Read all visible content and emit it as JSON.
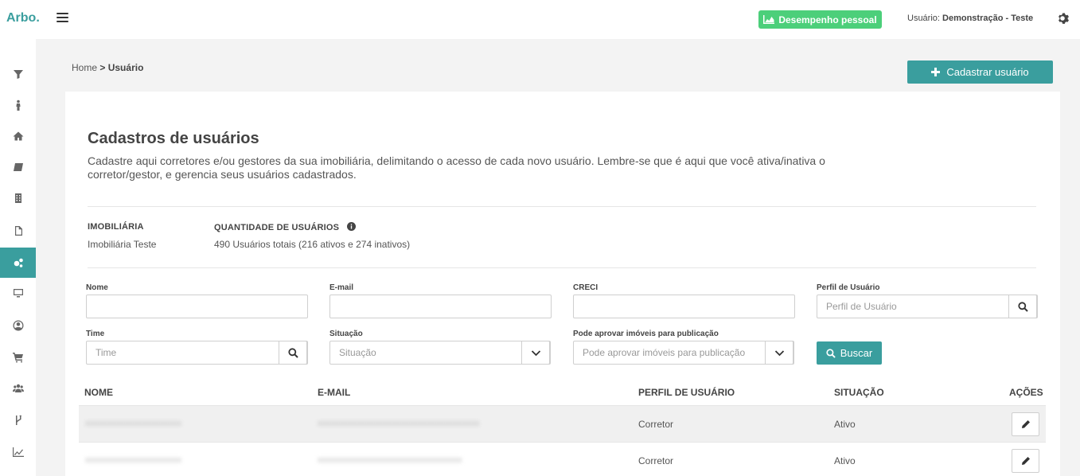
{
  "header": {
    "brand": "Arbo.",
    "performance_button": "Desempenho pessoal",
    "user_prefix": "Usuário:",
    "user_name": "Demonstração - Teste"
  },
  "sidebar": {
    "items": [
      {
        "icon": "filter-icon"
      },
      {
        "icon": "person-icon"
      },
      {
        "icon": "home-icon"
      },
      {
        "icon": "book-icon"
      },
      {
        "icon": "building-icon"
      },
      {
        "icon": "document-icon"
      },
      {
        "icon": "gears-icon",
        "active": true
      },
      {
        "icon": "monitor-icon"
      },
      {
        "icon": "user-circle-icon"
      },
      {
        "icon": "cart-icon"
      },
      {
        "icon": "users-icon"
      },
      {
        "icon": "fork-icon"
      },
      {
        "icon": "chart-icon"
      }
    ]
  },
  "breadcrumb": {
    "home": "Home",
    "separator": ">",
    "current": "Usuário"
  },
  "add_user_button": "Cadastrar usuário",
  "page": {
    "title": "Cadastros de usuários",
    "description": "Cadastre aqui corretores e/ou gestores da sua imobiliária, delimitando o acesso de cada novo usuário. Lembre-se que é aqui que você ativa/inativa o corretor/gestor, e gerencia seus usuários cadastrados."
  },
  "info": {
    "agency_label": "IMOBILIÁRIA",
    "agency_value": "Imobiliária Teste",
    "count_label": "QUANTIDADE DE USUÁRIOS",
    "count_value": "490 Usuários totais (216 ativos e 274 inativos)"
  },
  "filters": {
    "nome_label": "Nome",
    "nome_value": "",
    "email_label": "E-mail",
    "email_value": "",
    "creci_label": "CRECI",
    "creci_value": "",
    "perfil_label": "Perfil de Usuário",
    "perfil_placeholder": "Perfil de Usuário",
    "time_label": "Time",
    "time_placeholder": "Time",
    "situacao_label": "Situação",
    "situacao_placeholder": "Situação",
    "aprovar_label": "Pode aprovar imóveis para publicação",
    "aprovar_placeholder": "Pode aprovar imóveis para publicação",
    "buscar_label": "Buscar"
  },
  "table": {
    "headers": [
      "NOME",
      "E-MAIL",
      "PERFIL DE USUÁRIO",
      "SITUAÇÃO",
      "AÇÕES"
    ],
    "rows": [
      {
        "nome": "xxxxxxxxxxxxxxxxxxxxxx",
        "email": "xxxxxxxxxxxxxxxxxxxxxxxxxxxxxxxxxxxxx",
        "perfil": "Corretor",
        "situacao": "Ativo"
      },
      {
        "nome": "xxxxxxxxxxxxxxxxxxxxxx",
        "email": "xxxxxxxxxxxxxxxxxxxxxxxxxxxxxxxxx",
        "perfil": "Corretor",
        "situacao": "Ativo"
      }
    ]
  },
  "colors": {
    "accent": "#3a9e9e",
    "performance_green": "#4ccf7a"
  }
}
